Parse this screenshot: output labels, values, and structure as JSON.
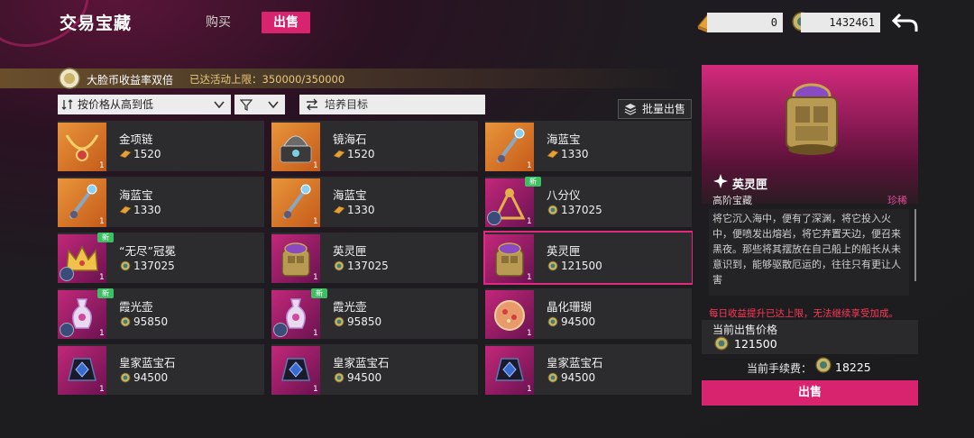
{
  "header": {
    "title": "交易宝藏",
    "tabs": [
      {
        "label": "购买",
        "active": false
      },
      {
        "label": "出售",
        "active": true
      }
    ],
    "currency_gold": "0",
    "currency_coin": "1432461",
    "back_icon": "back-arrow-icon"
  },
  "event": {
    "title": "大脸币收益率双倍",
    "limit": "已达活动上限：350000/350000"
  },
  "filters": {
    "sort_label": "按价格从高到低",
    "target_label": "培养目标",
    "batch_label": "批量出售"
  },
  "items": [
    {
      "name": "金项链",
      "price": "1520",
      "qty": "1",
      "thumb": "necklace",
      "bg": "orange",
      "currency": "gold",
      "is_new": false
    },
    {
      "name": "镜海石",
      "price": "1520",
      "qty": "1",
      "thumb": "stone-box",
      "bg": "orange",
      "currency": "gold",
      "is_new": false
    },
    {
      "name": "海蓝宝",
      "price": "1330",
      "qty": "1",
      "thumb": "scepter",
      "bg": "orange",
      "currency": "gold",
      "is_new": false
    },
    {
      "name": "海蓝宝",
      "price": "1330",
      "qty": "1",
      "thumb": "scepter",
      "bg": "orange",
      "currency": "gold",
      "is_new": false
    },
    {
      "name": "海蓝宝",
      "price": "1330",
      "qty": "1",
      "thumb": "scepter",
      "bg": "orange",
      "currency": "gold",
      "is_new": false
    },
    {
      "name": "八分仪",
      "price": "137025",
      "qty": "1",
      "thumb": "octant",
      "bg": "purple",
      "currency": "coin",
      "is_new": true
    },
    {
      "name": "“无尽”冠冕",
      "price": "137025",
      "qty": "1",
      "thumb": "crown",
      "bg": "purple",
      "currency": "coin",
      "is_new": true
    },
    {
      "name": "英灵匣",
      "price": "137025",
      "qty": "1",
      "thumb": "chest",
      "bg": "purple",
      "currency": "coin",
      "is_new": false
    },
    {
      "name": "英灵匣",
      "price": "121500",
      "qty": "1",
      "thumb": "chest",
      "bg": "purple",
      "currency": "coin",
      "is_new": false,
      "selected": true
    },
    {
      "name": "霞光壶",
      "price": "95850",
      "qty": "1",
      "thumb": "vase",
      "bg": "purple",
      "currency": "coin",
      "is_new": true
    },
    {
      "name": "霞光壶",
      "price": "95850",
      "qty": "1",
      "thumb": "vase",
      "bg": "purple",
      "currency": "coin",
      "is_new": true
    },
    {
      "name": "晶化珊瑚",
      "price": "94500",
      "qty": "1",
      "thumb": "coral",
      "bg": "purple",
      "currency": "coin",
      "is_new": false
    },
    {
      "name": "皇家蓝宝石",
      "price": "94500",
      "qty": "1",
      "thumb": "sapphire",
      "bg": "purple",
      "currency": "coin",
      "is_new": false
    },
    {
      "name": "皇家蓝宝石",
      "price": "94500",
      "qty": "1",
      "thumb": "sapphire",
      "bg": "purple",
      "currency": "coin",
      "is_new": false
    },
    {
      "name": "皇家蓝宝石",
      "price": "94500",
      "qty": "1",
      "thumb": "sapphire",
      "bg": "purple",
      "currency": "coin",
      "is_new": false
    }
  ],
  "detail": {
    "name": "英灵匣",
    "category": "高阶宝藏",
    "rarity": "珍稀",
    "description": "将它沉入海中，便有了深渊，将它投入火中，便喷发出熔岩，将它弃置天边，便召来黑夜。那些将其摆放在自己船上的船长从未意识到，能够驱散厄运的，往往只有更让人害",
    "warning": "每日收益提升已达上限，无法继续享受加成。",
    "price_label": "当前出售价格",
    "price": "121500",
    "fee_label": "当前手续费：",
    "fee": "18225",
    "sell_label": "出售"
  },
  "colors": {
    "accent": "#d8246f",
    "new_badge": "#3fbf64",
    "warning": "#ff3a5a",
    "rarity": "#e04a9a"
  }
}
